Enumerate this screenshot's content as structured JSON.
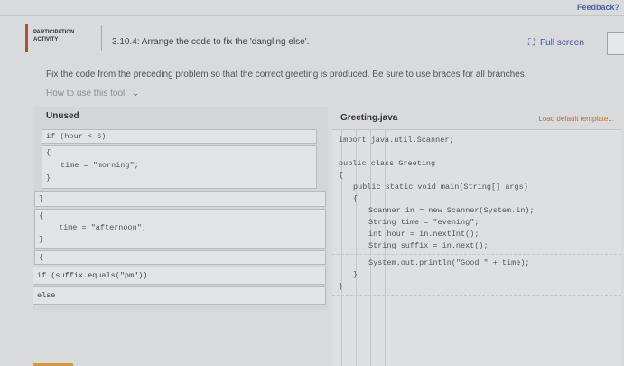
{
  "feedback_label": "Feedback?",
  "header": {
    "activity_label": "PARTICIPATION ACTIVITY",
    "title": "3.10.4: Arrange the code to fix the 'dangling else'.",
    "fullscreen_icon": "⛶",
    "fullscreen_label": "Full screen"
  },
  "instructions": "Fix the code from the preceding problem so that the correct greeting is produced. Be sure to use braces for all branches.",
  "how_to": {
    "label": "How to use this tool",
    "chevron": "⌄"
  },
  "unused": {
    "title": "Unused",
    "blocks": [
      "if (hour < 6)",
      "{",
      "time = \"morning\";",
      "}",
      "}",
      "{",
      "time = \"afternoon\";",
      "}",
      "{",
      "if (suffix.equals(\"pm\"))",
      "else"
    ]
  },
  "code": {
    "file_name": "Greeting.java",
    "load_default": "Load default template...",
    "lines": [
      "import java.util.Scanner;",
      "public class Greeting",
      "{",
      "public static void main(String[] args)",
      "{",
      "Scanner in = new Scanner(System.in);",
      "String time = \"evening\";",
      "int hour = in.nextInt();",
      "String suffix = in.next();",
      "System.out.println(\"Good \" + time);",
      "}",
      "}"
    ]
  },
  "colors": {
    "accent": "#b84d2a",
    "link": "#3b5ba5",
    "load_default": "#c06f2c"
  }
}
